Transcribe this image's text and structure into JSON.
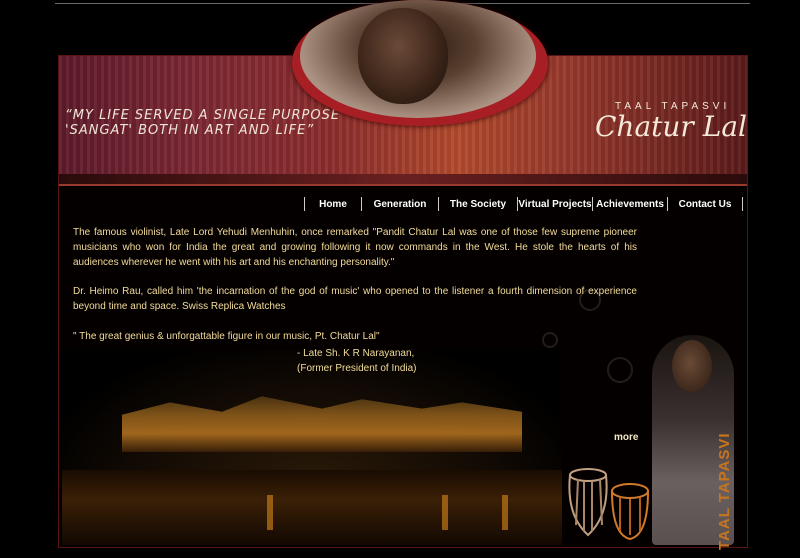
{
  "header": {
    "quote_line1": "“My life served a single purpose",
    "quote_line2": "'Sangat' both in art and life”",
    "logo_small": "TAAL TAPASVI",
    "logo_big": "Chatur Lal"
  },
  "nav": {
    "items": [
      {
        "label": "Home"
      },
      {
        "label": "Generation"
      },
      {
        "label": "The Society"
      },
      {
        "label": "Virtual Projects"
      },
      {
        "label": "Achievements"
      },
      {
        "label": "Contact Us"
      }
    ]
  },
  "content": {
    "p1": "The famous violinist, Late Lord Yehudi Menhuhin, once remarked \"Pandit Chatur Lal was one of those few supreme pioneer musicians who won for India the great and growing following it now commands in the West. He stole the hearts of his audiences wherever he went with his art and his enchanting personality.\"",
    "p2": "Dr. Heimo Rau, called him 'the incarnation of the god of music' who opened to the listener a fourth dimension of experience beyond time and space. Swiss Replica Watches",
    "p3": "\" The great genius & unforgattable figure in our music, Pt. Chatur Lal\"",
    "attribution1": "- Late Sh. K R Narayanan,",
    "attribution2": "(Former President of India)",
    "more": "more"
  },
  "side_label": "TAAL TAPASVI",
  "colors": {
    "background": "#000000",
    "text": "#f2dc9a",
    "accent": "#a71f24",
    "side_label": "#c8751e"
  }
}
